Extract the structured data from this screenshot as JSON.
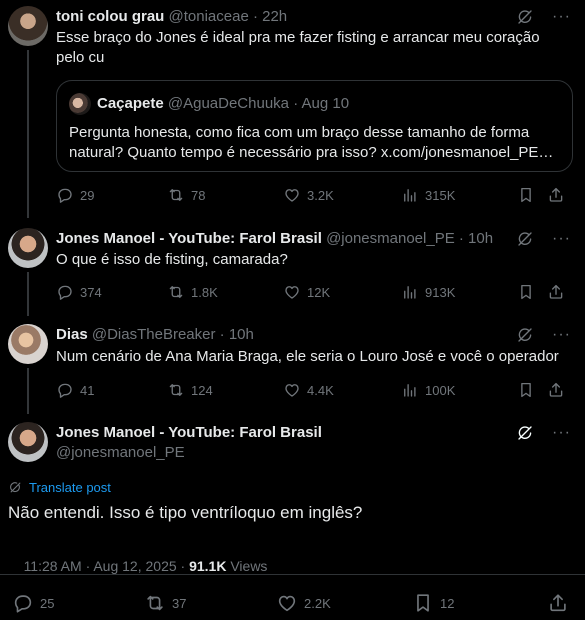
{
  "tweets": [
    {
      "name": "toni colou grau",
      "handle": "@toniaceae",
      "time": "22h",
      "text": "Esse braço do Jones é ideal pra me fazer fisting e arrancar meu coração pelo cu",
      "quote": {
        "name": "Caçapete",
        "handle": "@AguaDeChuuka",
        "time": "Aug 10",
        "text": "Pergunta honesta,  como fica com um braço desse tamanho de forma natural? Quanto tempo é necessário pra isso? x.com/jonesmanoel_PE…"
      },
      "replies": "29",
      "retweets": "78",
      "likes": "3.2K",
      "views": "315K"
    },
    {
      "name": "Jones Manoel - YouTube: Farol Brasil",
      "handle": "@jonesmanoel_PE",
      "time": "10h",
      "text": "O que é isso de fisting, camarada?",
      "replies": "374",
      "retweets": "1.8K",
      "likes": "12K",
      "views": "913K"
    },
    {
      "name": "Dias",
      "handle": "@DiasTheBreaker",
      "time": "10h",
      "text": "Num cenário de Ana Maria Braga, ele seria o Louro José e você o operador",
      "replies": "41",
      "retweets": "124",
      "likes": "4.4K",
      "views": "100K"
    }
  ],
  "main": {
    "name": "Jones Manoel - YouTube: Farol Brasil",
    "handle": "@jonesmanoel_PE",
    "translate": "Translate post",
    "text": "Não entendi. Isso é tipo ventríloquo em inglês?",
    "timestamp": "11:28 AM · Aug 12, 2025 · ",
    "views_count": "91.1K",
    "views_label": " Views",
    "replies": "25",
    "retweets": "37",
    "likes": "2.2K",
    "bookmarks": "12"
  },
  "icons": {
    "reply": "reply-icon",
    "retweet": "retweet-icon",
    "like": "heart-icon",
    "views": "views-icon",
    "bookmark": "bookmark-icon",
    "share": "share-icon",
    "grok": "grok-icon",
    "more": "more-icon",
    "translate": "globe-icon"
  },
  "colors": {
    "background": "#000000",
    "text": "#e7e9ea",
    "muted": "#71767b",
    "link": "#1d9bf0",
    "border": "#2f3336"
  }
}
